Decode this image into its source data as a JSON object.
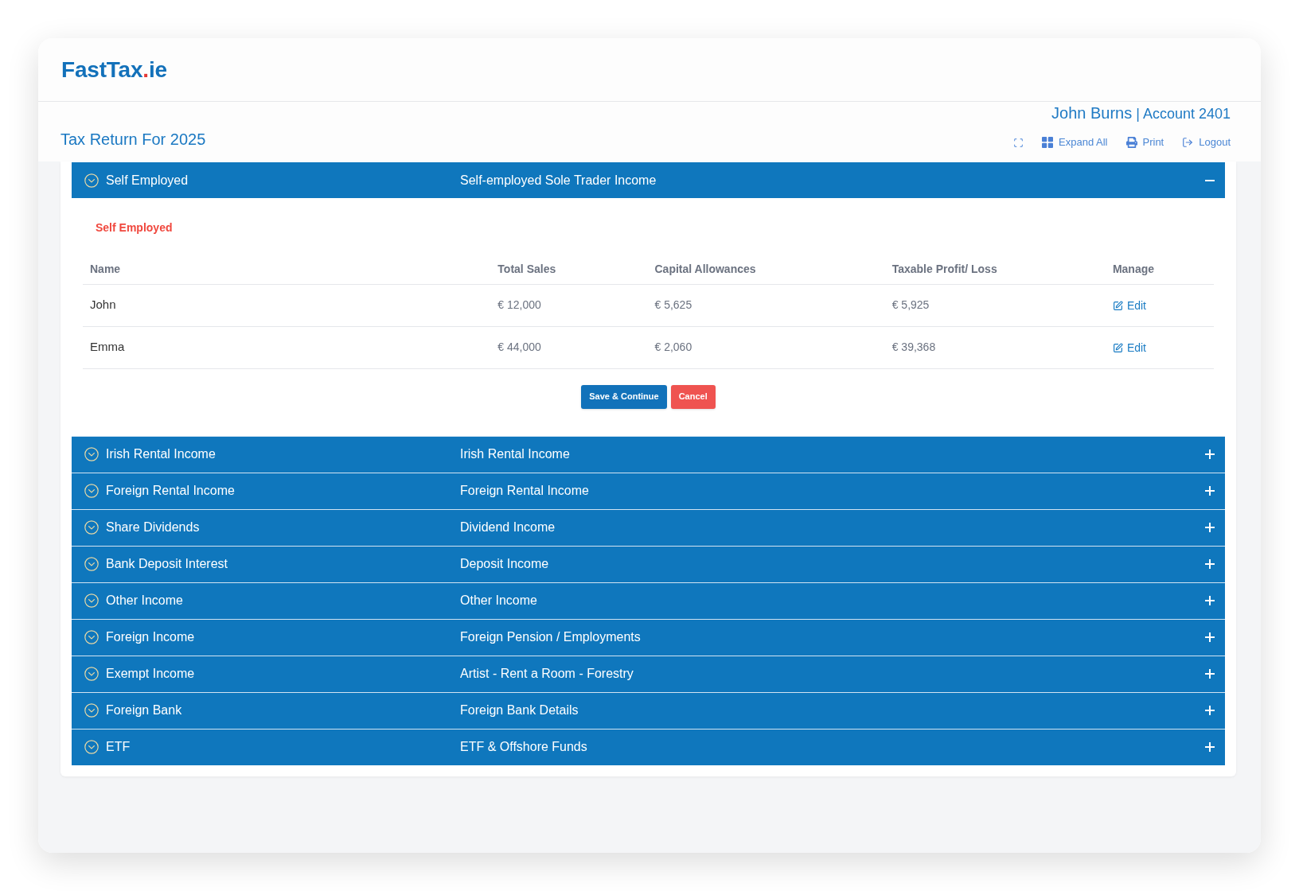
{
  "logo": {
    "name": "FastTax",
    "dot": ".",
    "tld": "ie"
  },
  "page_title": "Tax Return For 2025",
  "user": {
    "name": "John Burns",
    "separator": "|",
    "account": "Account 2401"
  },
  "toolbar": [
    {
      "kind": "fullscreen"
    },
    {
      "kind": "expand",
      "label": "Expand All"
    },
    {
      "kind": "print",
      "label": "Print"
    },
    {
      "kind": "logout",
      "label": "Logout"
    }
  ],
  "sections": [
    {
      "title": "Self Employed",
      "subtitle": "Self-employed Sole Trader Income",
      "expanded": true,
      "body": {
        "heading": "Self Employed",
        "table": {
          "columns": [
            "Name",
            "Total Sales",
            "Capital Allowances",
            "Taxable Profit/ Loss",
            "Manage"
          ],
          "rows": [
            {
              "cells": [
                "John",
                "€ 12,000",
                "€ 5,625",
                "€ 5,925"
              ],
              "action": "Edit"
            },
            {
              "cells": [
                "Emma",
                "€ 44,000",
                "€ 2,060",
                "€ 39,368"
              ],
              "action": "Edit"
            }
          ]
        },
        "buttons": [
          {
            "kind": "primary",
            "label": "Save & Continue"
          },
          {
            "kind": "danger",
            "label": "Cancel"
          }
        ]
      }
    },
    {
      "title": "Irish Rental Income",
      "subtitle": "Irish Rental Income",
      "expanded": false
    },
    {
      "title": "Foreign Rental Income",
      "subtitle": "Foreign Rental Income",
      "expanded": false
    },
    {
      "title": "Share Dividends",
      "subtitle": "Dividend Income",
      "expanded": false
    },
    {
      "title": "Bank Deposit Interest",
      "subtitle": "Deposit Income",
      "expanded": false
    },
    {
      "title": "Other Income",
      "subtitle": "Other Income",
      "expanded": false
    },
    {
      "title": "Foreign Income",
      "subtitle": "Foreign Pension / Employments",
      "expanded": false
    },
    {
      "title": "Exempt Income",
      "subtitle": "Artist - Rent a Room - Forestry",
      "expanded": false
    },
    {
      "title": "Foreign Bank",
      "subtitle": "Foreign Bank Details",
      "expanded": false
    },
    {
      "title": "ETF",
      "subtitle": "ETF & Offshore Funds",
      "expanded": false
    }
  ]
}
